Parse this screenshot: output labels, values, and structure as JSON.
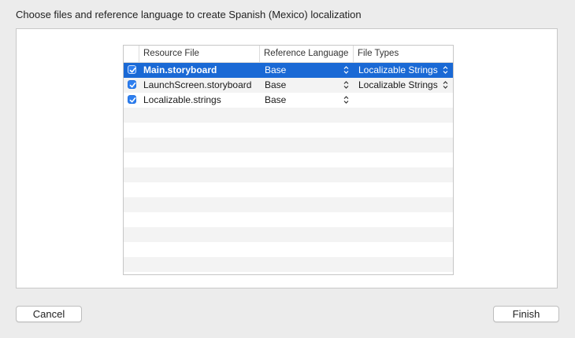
{
  "dialog": {
    "prompt": "Choose files and reference language to create Spanish (Mexico) localization"
  },
  "table": {
    "columns": [
      "",
      "Resource File",
      "Reference Language",
      "File Types"
    ],
    "rows": [
      {
        "checked": true,
        "file": "Main.storyboard",
        "reference_language": "Base",
        "file_type": "Localizable Strings",
        "selected": true
      },
      {
        "checked": true,
        "file": "LaunchScreen.storyboard",
        "reference_language": "Base",
        "file_type": "Localizable Strings",
        "selected": false
      },
      {
        "checked": true,
        "file": "Localizable.strings",
        "reference_language": "Base",
        "file_type": "",
        "selected": false
      }
    ]
  },
  "buttons": {
    "cancel_label": "Cancel",
    "finish_label": "Finish"
  },
  "colors": {
    "selection": "#1a69d5",
    "checkbox": "#2e7ff0"
  }
}
